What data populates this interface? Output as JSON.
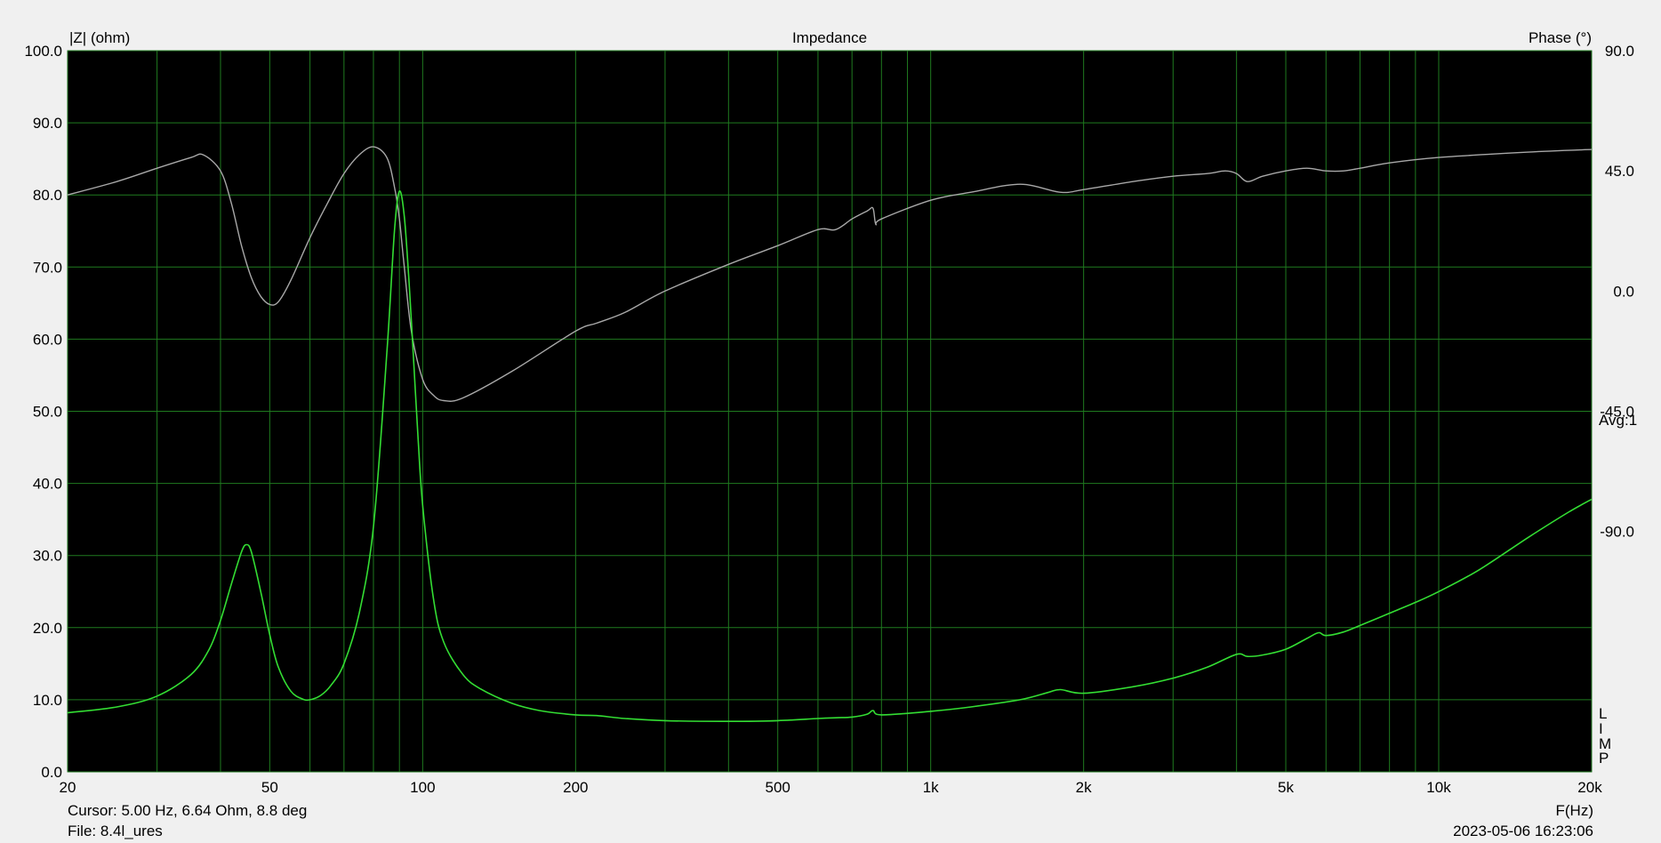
{
  "window": {
    "cursor_readout": "Cursor: 5.00 Hz, 6.64 Ohm, 8.8 deg",
    "file_label": "File: 8.4l_ures",
    "timestamp": "2023-05-06 16:23:06",
    "avg_label": "Avg:1",
    "limp_letters": [
      "L",
      "I",
      "M",
      "P"
    ]
  },
  "chart_data": {
    "type": "line",
    "title": "Impedance",
    "xlabel": "F(Hz)",
    "ylabel": "|Z| (ohm)",
    "y2label": "Phase (°)",
    "xscale": "log",
    "xlim": [
      20,
      20000
    ],
    "ylim": [
      0,
      100
    ],
    "y2lim": [
      -180,
      90
    ],
    "x_ticks": [
      20,
      50,
      100,
      200,
      500,
      1000,
      2000,
      5000,
      10000,
      20000
    ],
    "x_tick_labels": [
      "20",
      "50",
      "100",
      "200",
      "500",
      "1k",
      "2k",
      "5k",
      "10k",
      "20k"
    ],
    "y_ticks": [
      0,
      10,
      20,
      30,
      40,
      50,
      60,
      70,
      80,
      90,
      100
    ],
    "y_tick_labels": [
      "0.0",
      "10.0",
      "20.0",
      "30.0",
      "40.0",
      "50.0",
      "60.0",
      "70.0",
      "80.0",
      "90.0",
      "100.0"
    ],
    "y2_ticks": [
      90,
      45,
      0,
      -45,
      -90
    ],
    "y2_tick_labels": [
      "90.0",
      "45.0",
      "0.0",
      "-45.0",
      "-90.0"
    ],
    "grid": true,
    "colors": {
      "background": "#000000",
      "grid": "#1f7a1f",
      "impedance": "#33dd33",
      "phase": "#a8a8a8",
      "frame_bg": "#f0f0f0"
    },
    "series": [
      {
        "axis": "left",
        "x": [
          20,
          25,
          30,
          35,
          38,
          40,
          42,
          44,
          45,
          46,
          48,
          50,
          52,
          55,
          58,
          60,
          63,
          66,
          70,
          75,
          80,
          85,
          88,
          90,
          92,
          94,
          96,
          98,
          100,
          105,
          110,
          120,
          130,
          150,
          170,
          200,
          220,
          250,
          300,
          400,
          500,
          600,
          650,
          700,
          750,
          770,
          800,
          1000,
          1200,
          1500,
          1700,
          1800,
          2000,
          2500,
          3000,
          3500,
          4000,
          4200,
          4500,
          5000,
          5500,
          5800,
          6000,
          6500,
          7000,
          8000,
          9000,
          10000,
          12000,
          15000,
          18000,
          20000
        ],
        "values": [
          8.2,
          9.0,
          10.5,
          13.5,
          17.0,
          21.0,
          26.0,
          30.5,
          31.5,
          30.5,
          25.0,
          19.0,
          14.5,
          11.2,
          10.1,
          10.0,
          10.6,
          12.0,
          15.0,
          22.0,
          34.0,
          58.0,
          75.0,
          80.5,
          77.0,
          68.0,
          57.0,
          46.0,
          37.0,
          24.0,
          18.0,
          13.5,
          11.5,
          9.5,
          8.5,
          7.9,
          7.8,
          7.4,
          7.1,
          7.0,
          7.1,
          7.4,
          7.5,
          7.6,
          8.0,
          8.5,
          7.9,
          8.4,
          9.0,
          10.0,
          11.0,
          11.4,
          10.9,
          11.8,
          13.0,
          14.5,
          16.3,
          16.0,
          16.2,
          17.0,
          18.5,
          19.3,
          18.9,
          19.4,
          20.3,
          22.0,
          23.5,
          25.0,
          28.0,
          32.5,
          36.0,
          37.8
        ]
      },
      {
        "axis": "right",
        "x": [
          20,
          25,
          30,
          35,
          37,
          40,
          42,
          44,
          46,
          48,
          50,
          52,
          55,
          60,
          65,
          70,
          75,
          80,
          85,
          88,
          90,
          92,
          95,
          100,
          105,
          110,
          120,
          150,
          200,
          220,
          250,
          300,
          400,
          500,
          600,
          650,
          700,
          750,
          770,
          780,
          800,
          1000,
          1200,
          1500,
          1800,
          2000,
          2500,
          3000,
          3500,
          3800,
          4000,
          4200,
          4500,
          5000,
          5500,
          6000,
          6500,
          7000,
          8000,
          10000,
          15000,
          20000
        ],
        "values": [
          36,
          41,
          46,
          50,
          51,
          45,
          33,
          17,
          5,
          -2,
          -5,
          -4,
          4,
          20,
          33,
          44,
          51,
          54,
          50,
          39,
          27,
          9,
          -15,
          -33,
          -39,
          -41,
          -40,
          -30,
          -15,
          -12,
          -8,
          0,
          10,
          17,
          23,
          23,
          27,
          30,
          31,
          25,
          27,
          34,
          37,
          40,
          37,
          38,
          41,
          43,
          44,
          45,
          44,
          41,
          43,
          45,
          46,
          45,
          45,
          46,
          48,
          50,
          52,
          53
        ]
      }
    ]
  }
}
